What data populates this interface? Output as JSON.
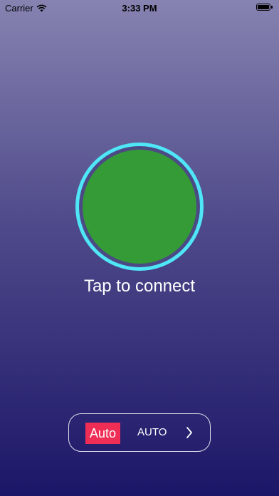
{
  "status_bar": {
    "carrier": "Carrier",
    "time": "3:33 PM"
  },
  "main": {
    "connect_label": "Tap to connect"
  },
  "mode_selector": {
    "badge": "Auto",
    "value": "AUTO"
  },
  "colors": {
    "ring": "#4fe6f7",
    "button_fill": "#349b37",
    "badge": "#ef2d55"
  }
}
